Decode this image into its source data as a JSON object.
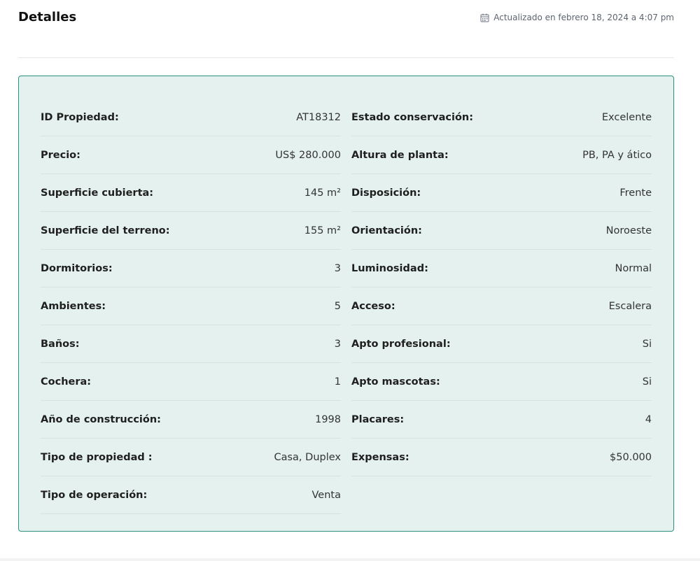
{
  "header": {
    "title": "Detalles",
    "updated_text": "Actualizado en febrero 18, 2024 a 4:07 pm",
    "updated_icon": "calendar-icon"
  },
  "colors": {
    "panel_bg": "#e4f1ee",
    "panel_border": "#2b9080"
  },
  "details": {
    "left": [
      {
        "label": "ID Propiedad:",
        "value": "AT18312"
      },
      {
        "label": "Precio:",
        "value": "US$ 280.000"
      },
      {
        "label": "Superficie cubierta:",
        "value": "145 m²"
      },
      {
        "label": "Superficie del terreno:",
        "value": "155 m²"
      },
      {
        "label": "Dormitorios:",
        "value": "3"
      },
      {
        "label": "Ambientes:",
        "value": "5"
      },
      {
        "label": "Baños:",
        "value": "3"
      },
      {
        "label": "Cochera:",
        "value": "1"
      },
      {
        "label": "Año de construcción:",
        "value": "1998"
      },
      {
        "label": "Tipo de propiedad :",
        "value": "Casa, Duplex"
      },
      {
        "label": "Tipo de operación:",
        "value": "Venta"
      }
    ],
    "right": [
      {
        "label": "Estado conservación:",
        "value": "Excelente"
      },
      {
        "label": "Altura de planta:",
        "value": "PB, PA y ático"
      },
      {
        "label": "Disposición:",
        "value": "Frente"
      },
      {
        "label": "Orientación:",
        "value": "Noroeste"
      },
      {
        "label": "Luminosidad:",
        "value": "Normal"
      },
      {
        "label": "Acceso:",
        "value": "Escalera"
      },
      {
        "label": "Apto profesional:",
        "value": "Si"
      },
      {
        "label": "Apto mascotas:",
        "value": "Si"
      },
      {
        "label": "Placares:",
        "value": "4"
      },
      {
        "label": "Expensas:",
        "value": "$50.000"
      }
    ]
  }
}
